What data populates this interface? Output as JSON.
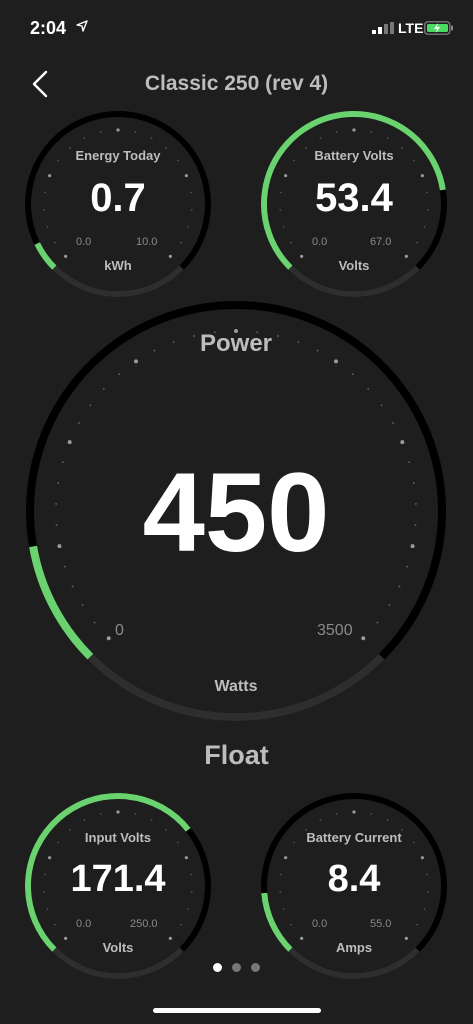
{
  "status_bar": {
    "time": "2:04",
    "carrier": "LTE"
  },
  "nav": {
    "title": "Classic 250 (rev 4)"
  },
  "accent_color": "#6ad36f",
  "gauges": {
    "energy": {
      "label": "Energy Today",
      "value": "0.7",
      "min": "0.0",
      "max": "10.0",
      "unit": "kWh",
      "fraction": 0.07
    },
    "battery_volts": {
      "label": "Battery Volts",
      "value": "53.4",
      "min": "0.0",
      "max": "67.0",
      "unit": "Volts",
      "fraction": 0.8
    },
    "power": {
      "label": "Power",
      "value": "450",
      "min": "0",
      "max": "3500",
      "unit": "Watts",
      "fraction": 0.13
    },
    "input_volts": {
      "label": "Input Volts",
      "value": "171.4",
      "min": "0.0",
      "max": "250.0",
      "unit": "Volts",
      "fraction": 0.69
    },
    "battery_current": {
      "label": "Battery Current",
      "value": "8.4",
      "min": "0.0",
      "max": "55.0",
      "unit": "Amps",
      "fraction": 0.15
    }
  },
  "charge_state": "Float",
  "pager": {
    "count": 3,
    "active": 0
  }
}
